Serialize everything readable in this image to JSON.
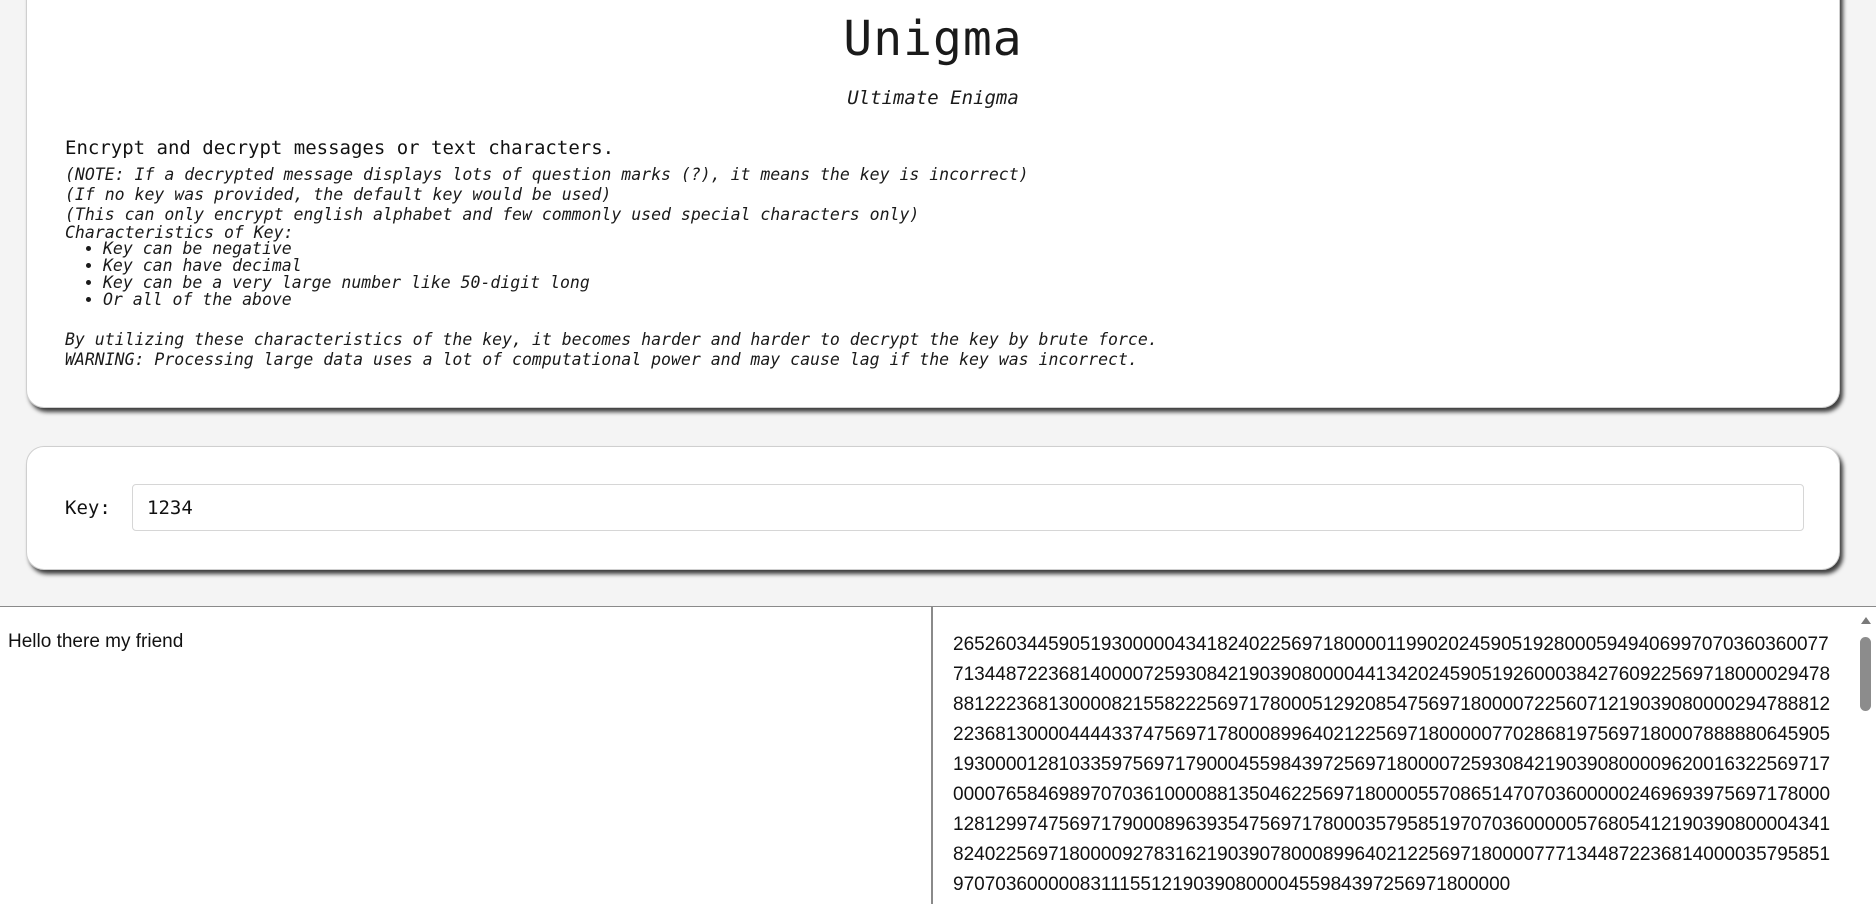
{
  "header": {
    "title": "Unigma",
    "subtitle": "Ultimate Enigma",
    "description": "Encrypt and decrypt messages or text characters.",
    "notes": [
      "(NOTE: If a decrypted message displays lots of question marks (?), it means the key is incorrect)",
      "(If no key was provided, the default key would be used)",
      "(This can only encrypt english alphabet and few commonly used special characters only)",
      "Characteristics of Key:"
    ],
    "characteristics": [
      "Key can be negative",
      "Key can have decimal",
      "Key can be a very large number like 50-digit long",
      "Or all of the above"
    ],
    "footer_notes": [
      "By utilizing these characteristics of the key, it becomes harder and harder to decrypt the key by brute force.",
      "WARNING: Processing large data uses a lot of computational power and may cause lag if the key was incorrect."
    ]
  },
  "key": {
    "label": "Key:",
    "value": "1234"
  },
  "io": {
    "plain_text": "Hello there my friend",
    "cipher_text": "265260344590519300000434182402256971800001199020245905192800059494069970703603600777134487223681400007259308421903908000044134202459051926000384276092256971800002947888122236813000082155822256971780005129208547569718000072256071219039080000294788812223681300004444337475697178000899640212256971800000770286819756971800078888806459051930000128103359756971790004559843972569718000072593084219039080000962001632256971700007658469897070361000088135046225697180000557086514707036000002469693975697178000128129974756971790008963935475697178000357958519707036000005768054121903908000043418240225697180000927831621903907800089964021225697180000777134487223681400003579585197070360000083111551219039080000455984397256971800000"
  },
  "colors": {
    "page_background": "#f4f4f4",
    "card_background": "#ffffff",
    "divider": "#8a8a8a"
  }
}
